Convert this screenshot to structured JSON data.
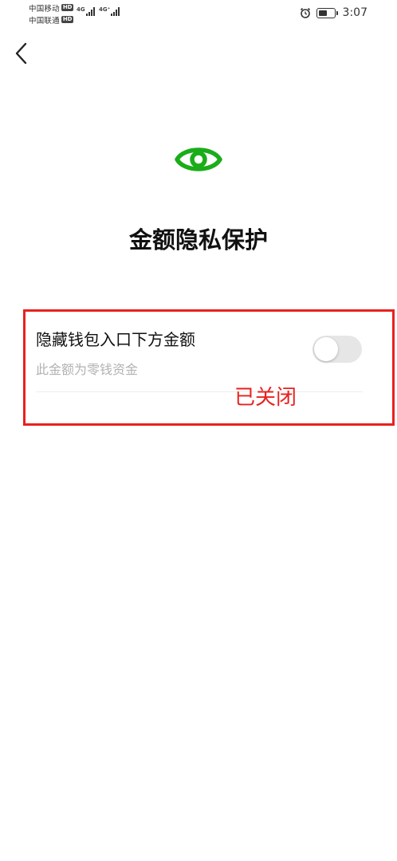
{
  "status_bar": {
    "carrier_1": "中国移动",
    "carrier_2": "中国联通",
    "hd_badge": "HD",
    "net_1": "4G",
    "net_2": "4G⁺",
    "time": "3:07",
    "battery_level": 0.6
  },
  "header": {
    "back_icon": "chevron-left-icon",
    "hero_icon": "eye-icon",
    "title": "金额隐私保护"
  },
  "setting": {
    "title": "隐藏钱包入口下方金额",
    "description": "此金额为零钱资金",
    "toggle_on": false
  },
  "annotation": {
    "text": "已关闭",
    "color": "#e8211f"
  },
  "colors": {
    "accent_green": "#1aad19",
    "toggle_off": "#e6e6e6",
    "annotation_red": "#e8211f"
  }
}
